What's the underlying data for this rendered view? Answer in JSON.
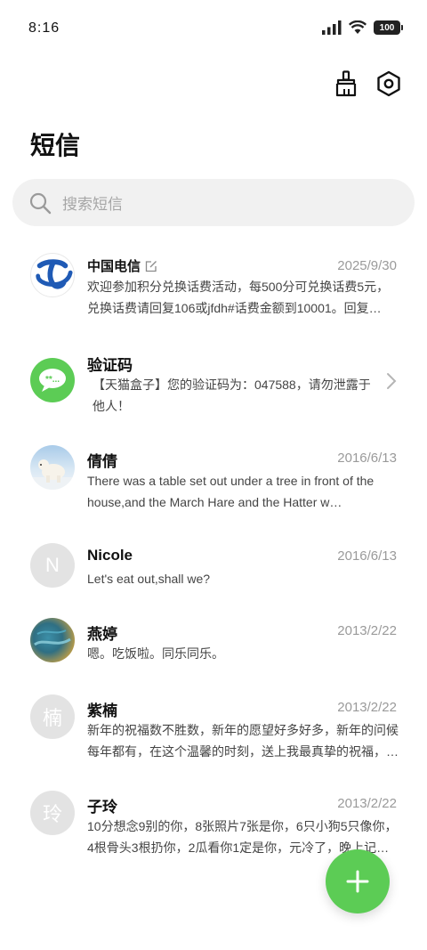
{
  "status_bar": {
    "time": "8:16",
    "battery": "100"
  },
  "page": {
    "title": "短信"
  },
  "search": {
    "placeholder": "搜索短信"
  },
  "messages": [
    {
      "name": "中国电信",
      "date": "2025/9/30",
      "preview": "欢迎参加积分兑换话费活动，每500分可兑换话费5元，兑换话费请回复106或jfdh#话费金额到10001。回复…",
      "avatar": "telecom-logo"
    },
    {
      "name": "验证码",
      "date": "",
      "preview": "【天猫盒子】您的验证码为：047588，请勿泄露于他人！",
      "avatar": "chat-bubble"
    },
    {
      "name": "倩倩",
      "date": "2016/6/13",
      "preview": "There was a table set out under a tree in front of the house,and the March Hare and the Hatter w…",
      "avatar": "polar-bear-photo"
    },
    {
      "name": "Nicole",
      "date": "2016/6/13",
      "preview": "Let's eat out,shall we?",
      "avatar_letter": "N"
    },
    {
      "name": "燕婷",
      "date": "2013/2/22",
      "preview": "嗯。吃饭啦。同乐同乐。",
      "avatar": "sea-photo"
    },
    {
      "name": "紫楠",
      "date": "2013/2/22",
      "preview": "新年的祝福数不胜数，新年的愿望好多好多，新年的问候每年都有，在这个温馨的时刻，送上我最真挚的祝福，愿你新年…",
      "avatar_letter": "楠"
    },
    {
      "name": "子玲",
      "date": "2013/2/22",
      "preview": "10分想念9别的你，8张照片7张是你，6只小狗5只像你，4根骨头3根扔你，2瓜看你1定是你，元冷了，晚上记得关…",
      "avatar_letter": "玲"
    }
  ],
  "colors": {
    "accent": "#5ccc55",
    "telecom_blue": "#1f5ab5",
    "date_gray": "#9a9a9a"
  }
}
